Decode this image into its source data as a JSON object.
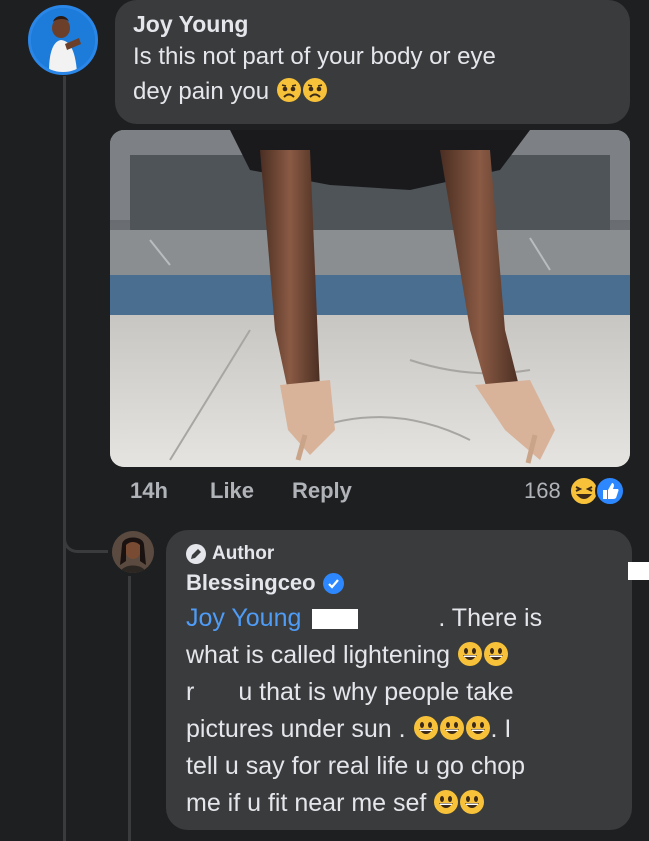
{
  "comment": {
    "author": "Joy Young",
    "text": "Is this not part of your body or eye dey pain you",
    "text_line1": "Is this not part of your body or eye",
    "text_line2": "dey pain you",
    "time": "14h",
    "like_label": "Like",
    "reply_label": "Reply",
    "reaction_count": "168",
    "reaction_icons": [
      "laughing-emoji-icon",
      "like-thumb-icon"
    ],
    "emoji": [
      "worried-face-icon",
      "worried-face-icon"
    ]
  },
  "reply": {
    "badge": "Author",
    "author": "Blessingceo",
    "verified": true,
    "mention": "Joy Young",
    "line1_tail": ". There is",
    "line2": "what is called lightening",
    "line3_a": "r",
    "line3_b": "u that is why people take",
    "line4": "pictures under sun .",
    "line4_tail": ". I",
    "line5": "tell u say for real life u go chop",
    "line6": "me if u fit near me sef"
  },
  "colors": {
    "background": "#1e1f21",
    "bubble": "#3a3b3c",
    "link": "#4f9cf7",
    "verified": "#2d88ff",
    "secondary_text": "#b0b3b8"
  }
}
